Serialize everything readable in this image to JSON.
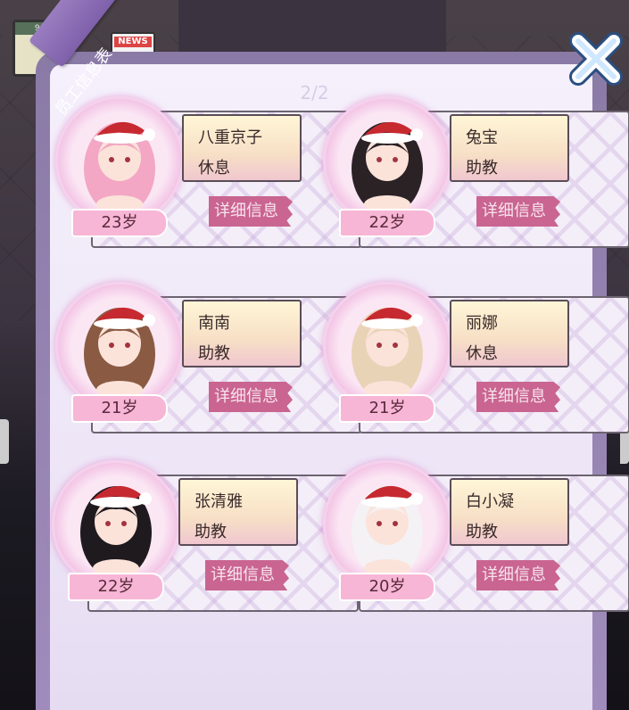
{
  "background": {
    "calendar_date": "9/16",
    "news_label": "NEWS"
  },
  "panel": {
    "title": "员工信息表",
    "page_indicator": "2/2"
  },
  "employees": [
    {
      "name": "八重京子",
      "role": "休息",
      "age": "23岁",
      "detail_label": "详细信息",
      "hair": "#f3a7c4"
    },
    {
      "name": "兔宝",
      "role": "助教",
      "age": "22岁",
      "detail_label": "详细信息",
      "hair": "#2b2226"
    },
    {
      "name": "南南",
      "role": "助教",
      "age": "21岁",
      "detail_label": "详细信息",
      "hair": "#8a5a42"
    },
    {
      "name": "丽娜",
      "role": "休息",
      "age": "21岁",
      "detail_label": "详细信息",
      "hair": "#e9d3b6"
    },
    {
      "name": "张清雅",
      "role": "助教",
      "age": "22岁",
      "detail_label": "详细信息",
      "hair": "#1f1a1e"
    },
    {
      "name": "白小凝",
      "role": "助教",
      "age": "20岁",
      "detail_label": "详细信息",
      "hair": "#f4f2f4"
    }
  ]
}
